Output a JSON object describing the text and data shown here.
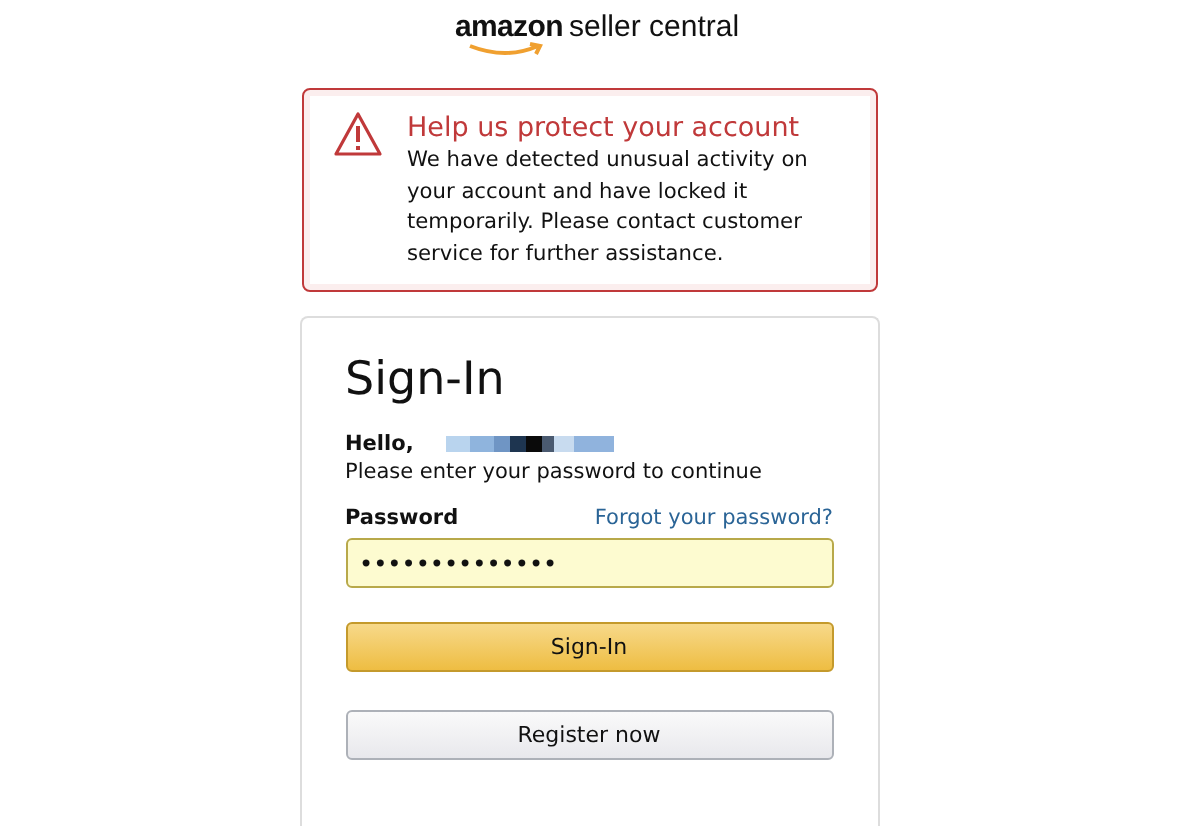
{
  "logo": {
    "brand": "amazon",
    "product": "seller central"
  },
  "alert": {
    "title": "Help us protect your account",
    "message": "We have detected unusual activity on your account and have locked it temporarily. Please contact customer service for further assistance."
  },
  "signin": {
    "title": "Sign-In",
    "greeting": "Hello,",
    "instruction": "Please enter your password to continue",
    "password_label": "Password",
    "forgot_link": "Forgot your password?",
    "password_value": "••••••••••••••",
    "buttons": [
      {
        "kind": "primary",
        "label": "Sign-In"
      },
      {
        "kind": "secondary",
        "label": "Register now"
      }
    ]
  }
}
